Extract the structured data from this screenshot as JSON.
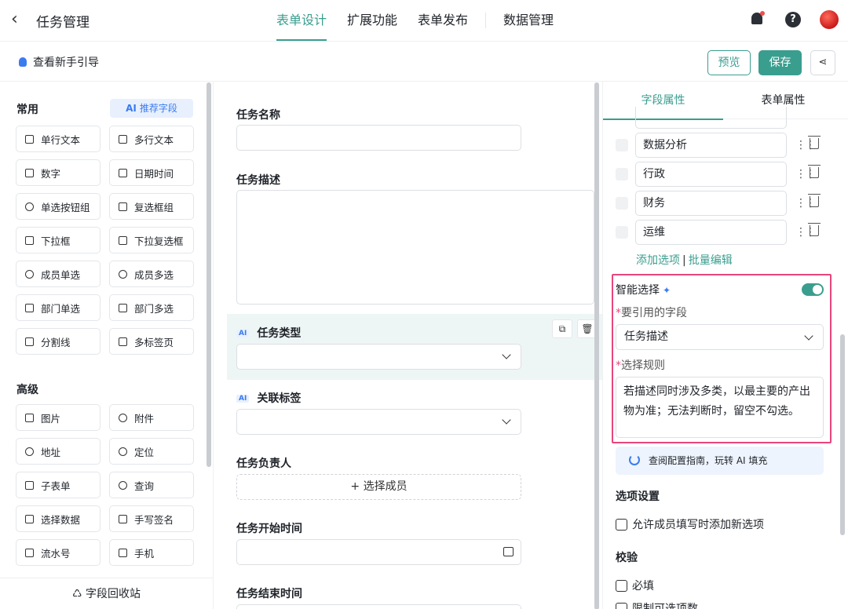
{
  "header": {
    "back_icon": "chevron-left",
    "title": "任务管理",
    "tabs": [
      "表单设计",
      "扩展功能",
      "表单发布",
      "数据管理"
    ],
    "active_tab": "表单设计",
    "help_label": "?"
  },
  "subbar": {
    "guide_label": "查看新手引导",
    "preview_label": "预览",
    "save_label": "保存",
    "share_icon": "share-icon",
    "share_glyph": "⋖"
  },
  "left_panel": {
    "common_title": "常用",
    "ai_recommend": "推荐字段",
    "ai_badge": "AI",
    "common_items": [
      "单行文本",
      "多行文本",
      "数字",
      "日期时间",
      "单选按钮组",
      "复选框组",
      "下拉框",
      "下拉复选框",
      "成员单选",
      "成员多选",
      "部门单选",
      "部门多选",
      "分割线",
      "多标签页"
    ],
    "advanced_title": "高级",
    "advanced_items": [
      "图片",
      "附件",
      "地址",
      "定位",
      "子表单",
      "查询",
      "选择数据",
      "手写签名",
      "流水号",
      "手机"
    ],
    "recycle_label": "字段回收站"
  },
  "canvas": {
    "fields": {
      "name_label": "任务名称",
      "desc_label": "任务描述",
      "type_label": "任务类型",
      "tags_label": "关联标签",
      "owner_label": "任务负责人",
      "owner_placeholder": "+ 选择成员",
      "start_label": "任务开始时间",
      "end_label": "任务结束时间"
    },
    "ai_tag": "AI",
    "copy_icon": "⧉",
    "delete_icon": "🗑"
  },
  "right_panel": {
    "tabs": [
      "字段属性",
      "表单属性"
    ],
    "active_tab": "字段属性",
    "options": [
      "数据分析",
      "行政",
      "财务",
      "运维"
    ],
    "drag_glyph": "⋮⋮",
    "add_option": "添加选项",
    "separator": "|",
    "batch_edit": "批量编辑",
    "smart_select": {
      "title": "智能选择",
      "spark": "✦",
      "enabled": true,
      "ref_field_label": "要引用的字段",
      "ref_field_value": "任务描述",
      "rule_label": "选择规则",
      "required_mark": "*",
      "rule_value": "若描述同时涉及多类，以最主要的产出物为准；无法判断时，留空不勾选。",
      "tip": "查阅配置指南，玩转 AI 填充"
    },
    "option_settings_title": "选项设置",
    "allow_new_option": "允许成员填写时添加新选项",
    "validation_title": "校验",
    "required_label": "必填",
    "limit_label": "限制可选项数"
  },
  "colors": {
    "accent": "#3a9e8f",
    "ai_blue": "#3a7bf0",
    "highlight_border": "#e8457c"
  }
}
